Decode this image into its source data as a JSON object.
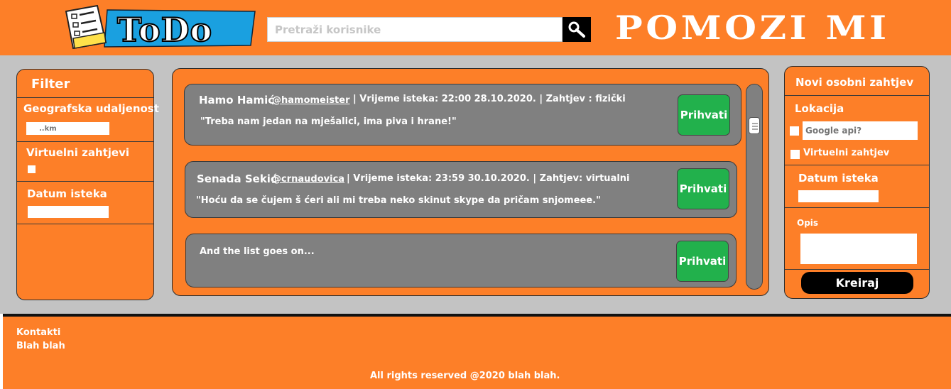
{
  "header": {
    "logo_text": "ToDo",
    "search_placeholder": "Pretraži korisnike",
    "search_icon": "search-icon",
    "brand": "POMOZI MI"
  },
  "filter": {
    "title": "Filter",
    "distance_label": "Geografska udaljenost",
    "distance_placeholder": "..km",
    "virtual_label": "Virtuelni zahtjevi",
    "expiry_label": "Datum isteka"
  },
  "feed": {
    "cards": [
      {
        "name": "Hamo Hamić",
        "handle": "@hamomeister",
        "meta": "| Vrijeme isteka: 22:00 28.10.2020. | Zahtjev : fizički",
        "message": "\"Treba nam jedan na mješalici, ima piva i hrane!\"",
        "button": "Prihvati"
      },
      {
        "name": "Senada Sekić",
        "handle": "@crnaudovica",
        "meta": "| Vrijeme isteka: 23:59 30.10.2020. | Zahtjev: virtualni",
        "message": "\"Hoću da se čujem š ćeri ali mi treba neko skinut skype da pričam snjomeee.\"",
        "button": "Prihvati"
      },
      {
        "message": "And the list goes on...",
        "button": "Prihvati"
      }
    ]
  },
  "new_request": {
    "title": "Novi osobni zahtjev",
    "location_label": "Lokacija",
    "location_placeholder": "Google api?",
    "virtual_label": "Virtuelni zahtjev",
    "expiry_label": "Datum isteka",
    "description_label": "Opis",
    "create_button": "Kreiraj"
  },
  "footer": {
    "contacts": "Kontakti",
    "blah": "Blah blah",
    "rights": "All rights reserved @2020 blah blah."
  },
  "colors": {
    "accent": "#fd7f28",
    "main_bg": "#c3c3c3",
    "card_bg": "#808080",
    "accept_green": "#22b14c"
  }
}
